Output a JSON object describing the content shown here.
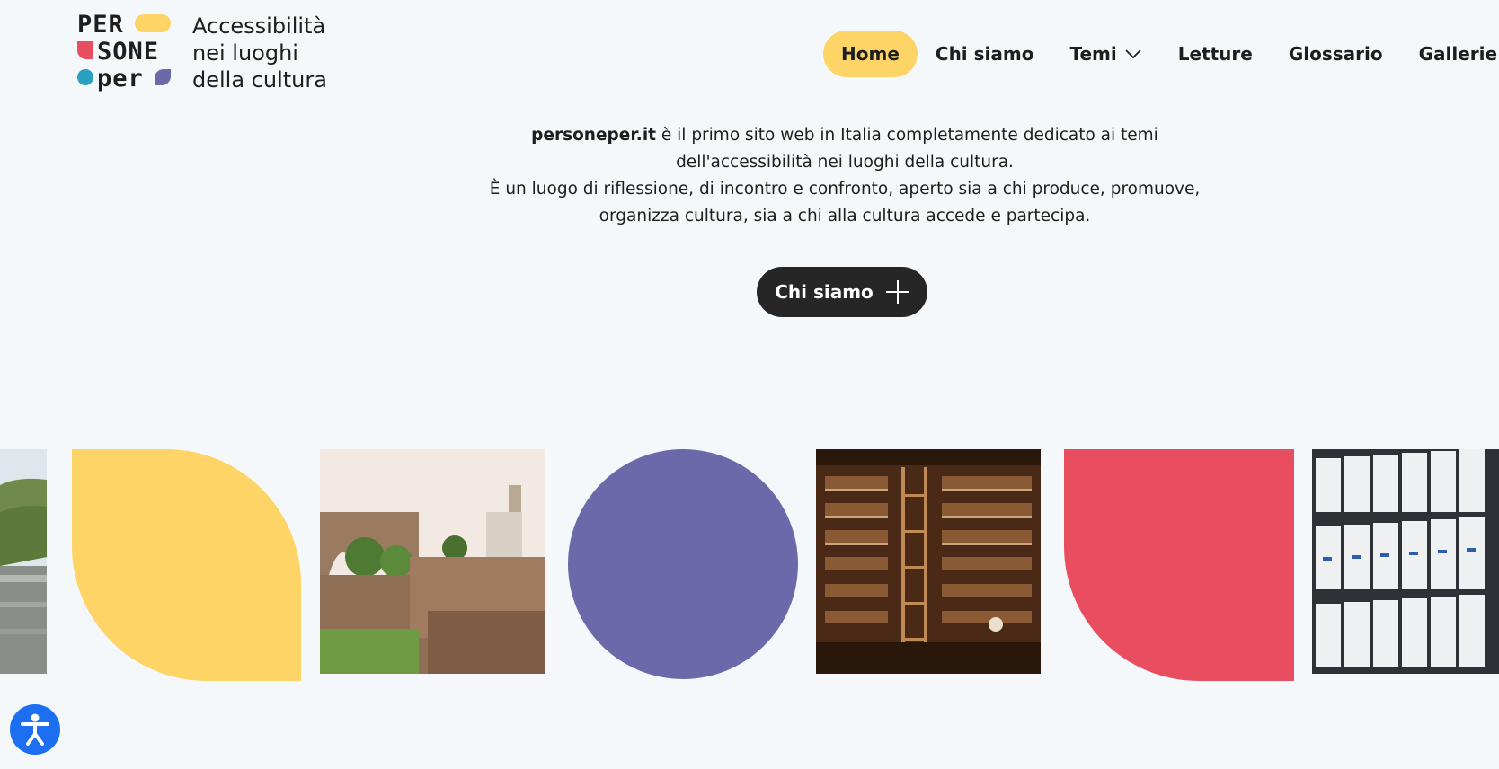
{
  "logo": {
    "mark_rows": [
      "PER",
      "SONE",
      "per"
    ],
    "tagline": [
      "Accessibilità",
      "nei luoghi",
      "della cultura"
    ]
  },
  "nav": {
    "items": [
      {
        "label": "Home",
        "active": true,
        "dropdown": false
      },
      {
        "label": "Chi siamo",
        "active": false,
        "dropdown": false
      },
      {
        "label": "Temi",
        "active": false,
        "dropdown": true
      },
      {
        "label": "Letture",
        "active": false,
        "dropdown": false
      },
      {
        "label": "Glossario",
        "active": false,
        "dropdown": false
      },
      {
        "label": "Gallerie",
        "active": false,
        "dropdown": true
      }
    ]
  },
  "intro": {
    "brand": "personeper.it",
    "line1_rest": " è il primo sito web in Italia completamente dedicato ai temi",
    "line2": "dell'accessibilità nei luoghi della cultura.",
    "line3": "È un luogo di riflessione, di incontro e confronto, aperto sia a chi produce, promuove,",
    "line4": "organizza cultura, sia a chi alla cultura accede e partecipa."
  },
  "cta": {
    "label": "Chi siamo"
  },
  "colors": {
    "background": "#f5f8fb",
    "yellow": "#ffd466",
    "purple": "#6c69aa",
    "red": "#e84e5f",
    "teal": "#2aa0c0",
    "dark": "#262626",
    "access_blue": "#1c6ff0"
  },
  "gallery": {
    "tiles": [
      {
        "kind": "photo",
        "subject": "vineyard hills landscape"
      },
      {
        "kind": "shape",
        "color": "yellow",
        "form": "leaf"
      },
      {
        "kind": "photo",
        "subject": "roman ruins with bell tower"
      },
      {
        "kind": "shape",
        "color": "purple",
        "form": "circle"
      },
      {
        "kind": "photo",
        "subject": "library bookshelves with ladder"
      },
      {
        "kind": "shape",
        "color": "red",
        "form": "quarter-round"
      },
      {
        "kind": "photo",
        "subject": "archive boxes on shelves"
      }
    ]
  },
  "icons": {
    "chevron": "chevron-down-icon",
    "plus": "plus-icon",
    "accessibility": "accessibility-icon"
  }
}
